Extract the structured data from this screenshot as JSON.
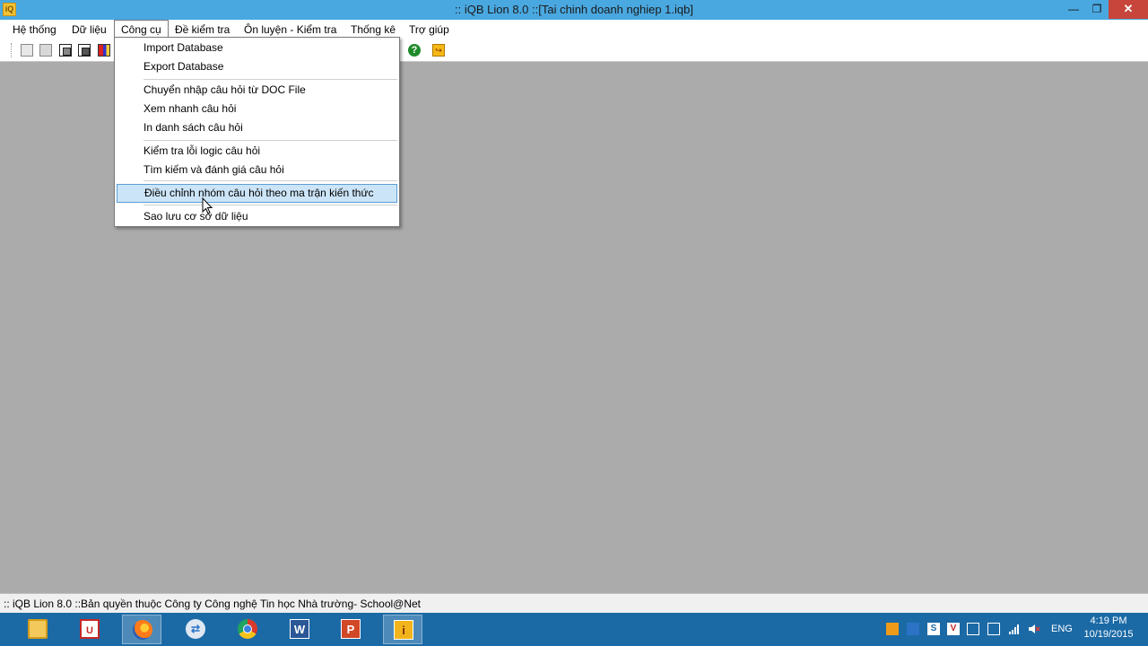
{
  "window": {
    "title": ":: iQB Lion 8.0 ::[Tai chinh doanh nghiep 1.iqb]",
    "app_icon_label": "iQ",
    "minimize_glyph": "—",
    "maximize_glyph": "❐",
    "close_glyph": "✕"
  },
  "menubar": {
    "items": [
      {
        "label": "Hệ thống"
      },
      {
        "label": "Dữ liệu"
      },
      {
        "label": "Công cụ"
      },
      {
        "label": "Đề kiểm tra"
      },
      {
        "label": "Ôn luyện - Kiểm tra"
      },
      {
        "label": "Thống kê"
      },
      {
        "label": "Trợ giúp"
      }
    ],
    "active_index": 2
  },
  "toolbar": {
    "help_glyph": "?",
    "exit_glyph": "↪"
  },
  "dropdown": {
    "items": [
      {
        "label": "Import Database"
      },
      {
        "label": "Export Database"
      },
      {
        "label": "Chuyển nhập câu hỏi từ DOC File"
      },
      {
        "label": "Xem nhanh câu hỏi"
      },
      {
        "label": "In danh sách câu hỏi"
      },
      {
        "label": "Kiểm tra lỗi logic câu hỏi"
      },
      {
        "label": "Tìm kiếm và đánh giá câu hỏi"
      },
      {
        "label": "Điều chỉnh nhóm câu hỏi theo ma trận kiến thức"
      },
      {
        "label": "Sao lưu cơ sở dữ liệu"
      }
    ],
    "highlighted_index": 7
  },
  "statusbar": {
    "text": ":: iQB Lion 8.0 ::Bản quyền thuộc Công ty Công nghệ Tin học Nhà trường- School@Net"
  },
  "taskbar": {
    "apps": [
      {
        "name": "file-explorer",
        "glyph": ""
      },
      {
        "name": "unikey",
        "glyph": "U"
      },
      {
        "name": "firefox",
        "glyph": ""
      },
      {
        "name": "teamviewer",
        "glyph": "⇄"
      },
      {
        "name": "chrome",
        "glyph": ""
      },
      {
        "name": "word",
        "glyph": "W"
      },
      {
        "name": "powerpoint",
        "glyph": "P"
      },
      {
        "name": "iqb-lion",
        "glyph": "i"
      }
    ],
    "active_app": "iqb-lion",
    "language": "ENG",
    "time": "4:19 PM",
    "date": "10/19/2015"
  },
  "colors": {
    "title_bar": "#4aa8e0",
    "close_button": "#c7453a",
    "workspace": "#ababab",
    "menu_highlight": "#cce4f7",
    "taskbar": "#1b6aa6"
  }
}
